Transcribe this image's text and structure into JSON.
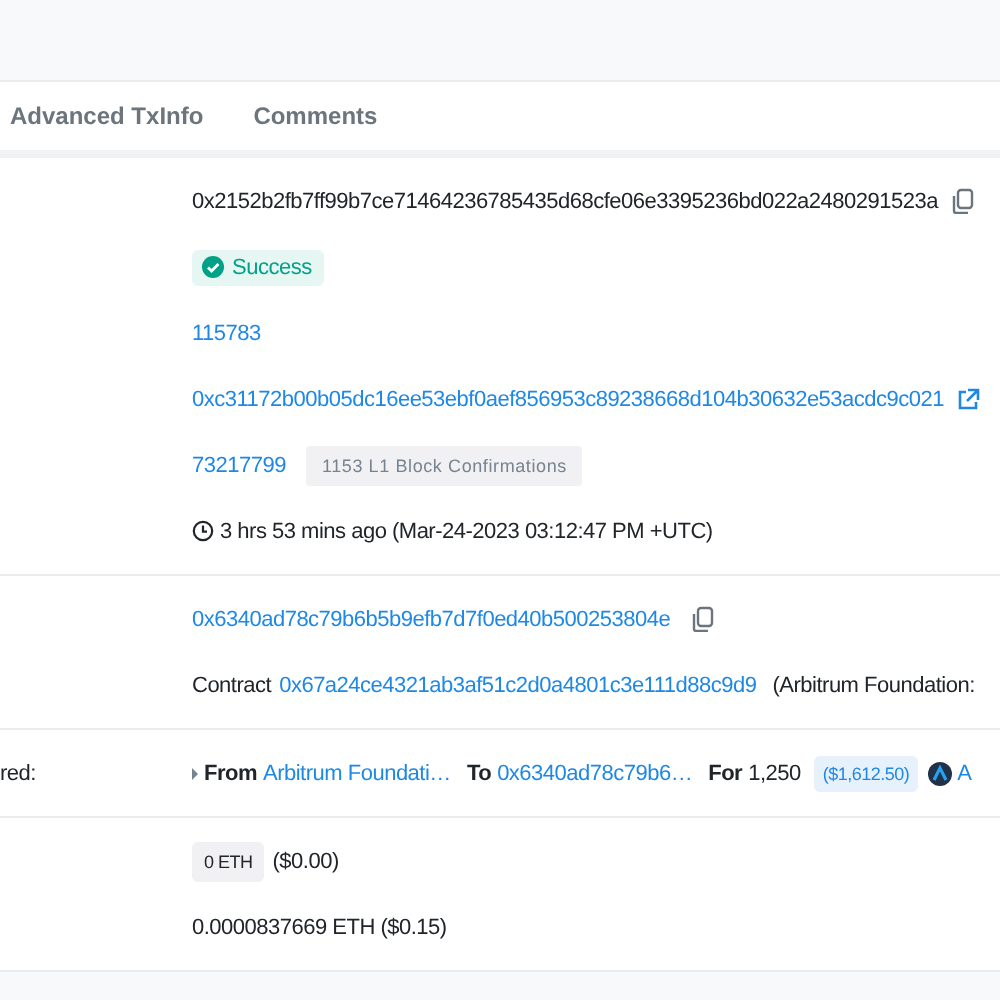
{
  "tabs": [
    {
      "label": "Advanced TxInfo",
      "selected": false
    },
    {
      "label": "Comments",
      "selected": false
    }
  ],
  "overview": {
    "transaction_hash": "0x2152b2fb7ff99b7ce71464236785435d68cfe06e3395236bd022a2480291523a",
    "status": "Success",
    "block": "115783",
    "l1_hash": "0xc31172b00b05dc16ee53ebf0aef856953c89238668d104b30632e53acdc9c021",
    "l1_block": "73217799",
    "confirmations": "1153 L1 Block Confirmations",
    "timestamp": "3 hrs 53 mins ago (Mar-24-2023 03:12:47 PM +UTC)"
  },
  "addresses": {
    "from": "0x6340ad78c79b6b5b9efb7d7f0ed40b500253804e",
    "to_prefix": "Contract",
    "to_address": "0x67a24ce4321ab3af51c2d0a4801c3e111d88c9d9",
    "to_name": "(Arbitrum Foundation:"
  },
  "transfers": {
    "label": "red:",
    "items": [
      {
        "from_label": "From",
        "from": "Arbitrum Foundati…",
        "to_label": "To",
        "to": "0x6340ad78c79b6…",
        "for_label": "For",
        "amount": "1,250",
        "usd": "($1,612.50)",
        "token": "A"
      }
    ]
  },
  "value": {
    "amount": "0 ETH",
    "usd": "($0.00)"
  },
  "fee": "0.0000837669 ETH ($0.15)"
}
